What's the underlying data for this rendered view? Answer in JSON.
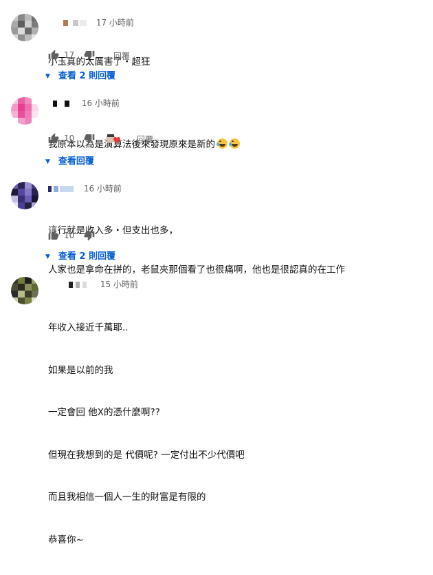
{
  "comments": [
    {
      "time": "17 小時前",
      "lines": [
        "小玉真的太厲害了・超狂"
      ],
      "likes": "17",
      "reply_label": "回覆",
      "view_replies": "查看 2 則回覆",
      "avatar_colors": [
        "#c9c9c9",
        "#8a8a8a",
        "#b9b9b9",
        "#6f6f6f",
        "#a8a8a8",
        "#5e5e5e",
        "#cfcfcf",
        "#7b7b7b",
        "#9a9a9a",
        "#dcdcdc",
        "#6a6a6a",
        "#b0b0b0",
        "#d6d6d6",
        "#8f8f8f",
        "#bdbdbd",
        "#e4e4e4"
      ]
    },
    {
      "time": "16 小時前",
      "lines": [
        "我原本以為是演算法後來發現原來是新的"
      ],
      "emoji": [
        "grinning-squinting-face-emoji",
        "grinning-squinting-face-emoji"
      ],
      "likes": "10",
      "reply_label": "回覆",
      "view_replies": "查看回覆",
      "avatar_colors": [
        "#f7c7dd",
        "#ec5fa6",
        "#f28cc0",
        "#ffffff",
        "#f39ac7",
        "#e73f94",
        "#ee6fb0",
        "#f9d6e8",
        "#f5b3d4",
        "#ea4f9d",
        "#f07ab8",
        "#fbe3ef",
        "#ffffff",
        "#f3a3cb",
        "#ef84bc",
        "#ffffff"
      ]
    },
    {
      "time": "16 小時前",
      "lines": [
        "這行就是收入多・但支出也多，",
        "人家也是拿命在拼的，老鼠夾那個看了也很痛啊，他也是很認真的在工作"
      ],
      "likes": "10",
      "reply_label": "",
      "view_replies": "查看 2 則回覆",
      "avatar_colors": [
        "#6b5ca8",
        "#2c2456",
        "#9b8fd0",
        "#3f3580",
        "#1e1a3a",
        "#5548a0",
        "#8376c4",
        "#2a224e",
        "#c4bde6",
        "#3a3070",
        "#6a5db4",
        "#181530",
        "#e6e3f4",
        "#4b4092",
        "#24203f",
        "#b0a6dc"
      ]
    },
    {
      "time": "15 小時前",
      "lines": [
        "年收入接近千萬耶..",
        "如果是以前的我",
        "一定會回 他X的憑什麼啊??",
        "但現在我想到的是 代價呢? 一定付出不少代價吧",
        "而且我相信一個人一生的財富是有限的",
        "恭喜你~"
      ],
      "avatar_colors": [
        "#3a3a2a",
        "#6e7d3e",
        "#1e1e1e",
        "#9aa06a",
        "#4d4d3a",
        "#2b2b22",
        "#8c8f5a",
        "#5d6b33",
        "#2a2a2a",
        "#b8bc8a",
        "#3c3f28",
        "#6f6f55",
        "#c9ccae",
        "#4a5030",
        "#7d8245",
        "#e0e2cf"
      ]
    }
  ],
  "colors": {
    "link_blue": "#065fd4",
    "meta_gray": "#606060",
    "heart_red": "#e53935"
  }
}
